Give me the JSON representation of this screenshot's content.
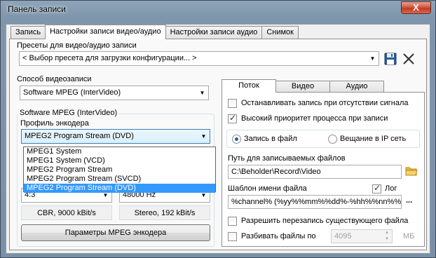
{
  "window": {
    "title": "Панель записи",
    "close_glyph": "X"
  },
  "tabs": [
    {
      "label": "Запись",
      "active": false
    },
    {
      "label": "Настройки записи видео/аудио",
      "active": true
    },
    {
      "label": "Настройки записи аудио",
      "active": false
    },
    {
      "label": "Снимок",
      "active": false
    }
  ],
  "presets": {
    "label": "Пресеты для видео/аудио записи",
    "selected": "< Выбор пресета для загрузки конфигурации... >",
    "save_icon": "floppy-icon",
    "delete_icon": "x-icon"
  },
  "capture_method": {
    "label": "Способ видеозаписи",
    "selected": "Software MPEG (InterVideo)"
  },
  "encoder_group": {
    "title": "Software MPEG (InterVideo)",
    "profile_label": "Профиль энкодера",
    "profile_selected": "MPEG2 Program Stream (DVD)",
    "profile_options": [
      "MPEG1 System",
      "MPEG1 System (VCD)",
      "MPEG2 Program Stream",
      "MPEG2 Program Stream (SVCD)",
      "MPEG2 Program Stream (DVD)"
    ],
    "aspect_selected": "4:3",
    "audio_rate_selected": "48000 Hz",
    "video_info": "CBR, 9000 kBit/s",
    "audio_info": "Stereo, 192 kBit/s",
    "params_button": "Параметры MPEG энкодера"
  },
  "inner_tabs": [
    {
      "label": "Поток",
      "active": true
    },
    {
      "label": "Видео",
      "active": false
    },
    {
      "label": "Аудио",
      "active": false
    }
  ],
  "stream": {
    "stop_on_no_signal": {
      "label": "Останавливать запись при отсутствии сигнала",
      "checked": false
    },
    "high_priority": {
      "label": "Высокий приоритет процесса при записи",
      "checked": true
    },
    "record_to_file": {
      "label": "Запись в файл",
      "selected": true
    },
    "broadcast": {
      "label": "Вещание в IP сеть",
      "selected": false
    },
    "path_label": "Путь для записываемых файлов",
    "path_value": "C:\\Beholder\\Record\\Video",
    "template_label": "Шаблон имени файла",
    "log": {
      "label": "Лог",
      "checked": true
    },
    "template_value": "%channel% (%yy%%mm%%dd%-%hh%%nn%%ss%)",
    "browse_label": "...",
    "allow_overwrite": {
      "label": "Разрешить перезапись существующего файла",
      "checked": false
    },
    "split_files": {
      "label": "Разбивать файлы по",
      "checked": false
    },
    "split_value": "4095",
    "split_unit": "МБ"
  }
}
